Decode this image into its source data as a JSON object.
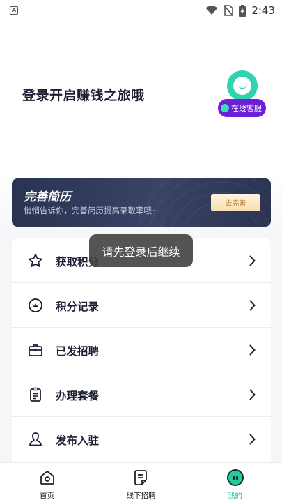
{
  "status_bar": {
    "notification_icon_label": "A",
    "time": "2:43",
    "icons": [
      "wifi-icon",
      "no-sim-icon",
      "battery-charging-icon"
    ]
  },
  "header": {
    "login_title": "登录开启赚钱之旅哦",
    "service_label": "在线客服"
  },
  "resume_banner": {
    "title": "完善简历",
    "subtitle": "悄悄告诉你，完善简历提高录取率哦~",
    "button_label": "去完善"
  },
  "menu": {
    "items": [
      {
        "label": "获取积分",
        "icon": "star-icon"
      },
      {
        "label": "积分记录",
        "icon": "points-record-icon"
      },
      {
        "label": "已发招聘",
        "icon": "briefcase-icon"
      },
      {
        "label": "办理套餐",
        "icon": "clipboard-icon"
      },
      {
        "label": "发布入驻",
        "icon": "person-icon"
      }
    ]
  },
  "toast": {
    "message": "请先登录后继续"
  },
  "bottom_nav": {
    "items": [
      {
        "label": "首页",
        "icon": "home-icon"
      },
      {
        "label": "线下招聘",
        "icon": "document-icon"
      },
      {
        "label": "我的",
        "icon": "mine-icon",
        "active": true
      }
    ]
  },
  "colors": {
    "accent": "#22c19a",
    "service_badge": "#6c1fd6",
    "banner_bg": "#2b3352",
    "banner_button_text": "#b8822f"
  }
}
